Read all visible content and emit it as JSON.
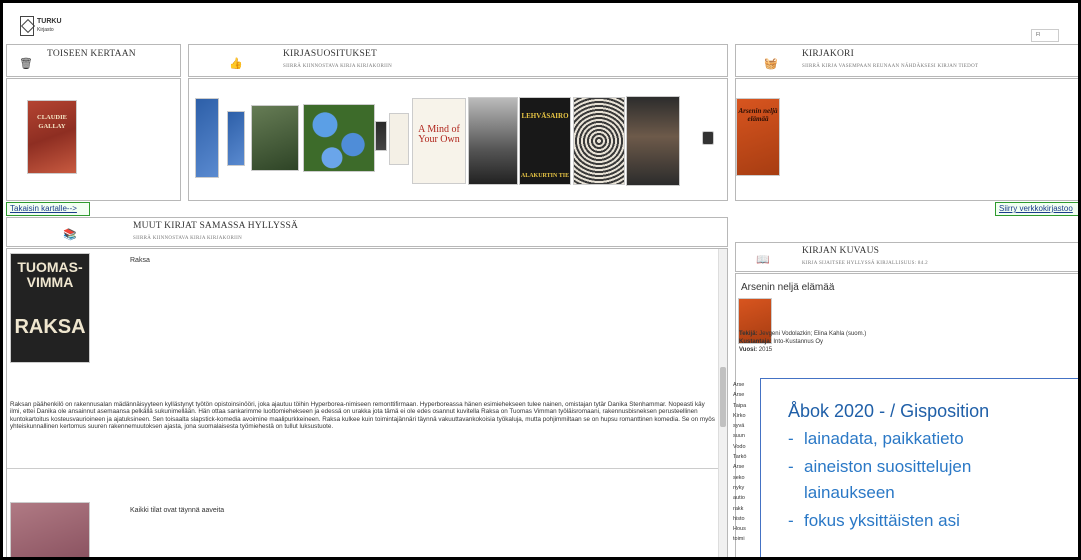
{
  "header": {
    "logo_title": "TURKU",
    "logo_subtitle": "Kirjasto",
    "language": "FI"
  },
  "panels": {
    "second_time": {
      "title": "TOISEEN KERTAAN",
      "icon": "trash-icon"
    },
    "recommendations": {
      "title": "KIRJASUOSITUKSET",
      "subtitle": "SIIRRÄ KIINNOSTAVA KIRJA KIRJAKORIIN",
      "icon": "thumbs-up-icon"
    },
    "basket": {
      "title": "KIRJAKORI",
      "subtitle": "SIIRRÄ KIRJA VASEMPAAN REUNAAN NÄHDÄKSESI KIRJAN TIEDOT",
      "icon": "basket-icon"
    },
    "same_shelf": {
      "title": "MUUT KIRJAT SAMASSA HYLLYSSÄ",
      "subtitle": "SIIRRÄ KIINNOSTAVA KIRJA KIRJAKORIIN",
      "icon": "books-icon"
    },
    "description": {
      "title": "KIRJAN KUVAUS",
      "subtitle": "KIRJA SIJAITSEE HYLLYSSÄ KIRJALLISUUS: 84.2",
      "icon": "open-book-icon"
    }
  },
  "buttons": {
    "back_to_map": "Takaisin kartalle-->",
    "to_web_library": "Siirry verkkokirjastoo"
  },
  "covers": {
    "gallay_author": "CLAUDIE GALLAY",
    "mind_of_your_own": "A Mind of Your Own",
    "lehvasairo": "LEHVÄSAIRO",
    "alakurtin_tie": "ALAKURTIN TIE",
    "arsenin_title": "Arsenin neljä elämää",
    "tuomas_vimma_author": "TUOMAS-VIMMA",
    "raksa_cover_title": "RAKSA"
  },
  "shelf_books": [
    {
      "title": "Raksa",
      "description": "Raksan päähenkilö on rakennusalan mädännäisyyteen kyllästynyt työtön opistoinsinööri, joka ajautuu töihin Hyperborea-nimiseen remonttifirmaan. Hyperboreassa hänen esimiehekseen tulee nainen, omistajan tytär Danika Stenhammar. Nopeasti käy ilmi, ettei Danika ole ansainnut asemaansa pelkällä sukunimellään. Hän ottaa sankarimme luottomiehekseen ja edessä on urakka jota tämä ei ole edes osannut kuvitella Raksa on Tuomas Vimman työläisromaani, rakennusbisneksen perusteellinen kuntokartoitus kosteusvaurioineen ja ajatuksineen. Sen toisaalta slapstick-komedia avoimine maalipurkkeineen. Raksa kulkee kuin toimintajännäri täynnä vakuuttavankokoisia työkaluja, mutta pohjimmiltaan se on hupsu romanttinen komedia. Se on myös yhteiskunnallinen kertomus suuren rakennemuutoksen ajasta, jona suomalaisesta työmiehestä on tullut luksustuote."
    },
    {
      "title": "Kaikki tilat ovat täynnä aaveita",
      "description": ""
    }
  ],
  "detail": {
    "title": "Arsenin neljä elämää",
    "author_label": "Tekijä:",
    "author": "Jevgeni Vodolazkin; Elina Kahla (suom.)",
    "publisher_label": "Kustantaja:",
    "publisher": "Into-Kustannus Oy",
    "year_label": "Vuosi:",
    "year": "2015",
    "clipped_lines": [
      "Arse",
      "Arse",
      "Taipa",
      "Kirko",
      "syvä",
      "suun",
      "Vodo",
      "Tarkö",
      "Arse",
      "seko",
      "nyky",
      "autio",
      "rakk",
      "histo",
      "Hous",
      "toimi"
    ]
  },
  "overlay": {
    "title": "Åbok 2020 - / Gisposition",
    "items": [
      {
        "bullet": "-",
        "text": "lainadata, paikkatieto"
      },
      {
        "bullet": "-",
        "text": "aineiston suosittelujen"
      },
      {
        "bullet": "",
        "text": "lainaukseen"
      },
      {
        "bullet": "-",
        "text": "fokus yksittäisten asi"
      }
    ]
  }
}
